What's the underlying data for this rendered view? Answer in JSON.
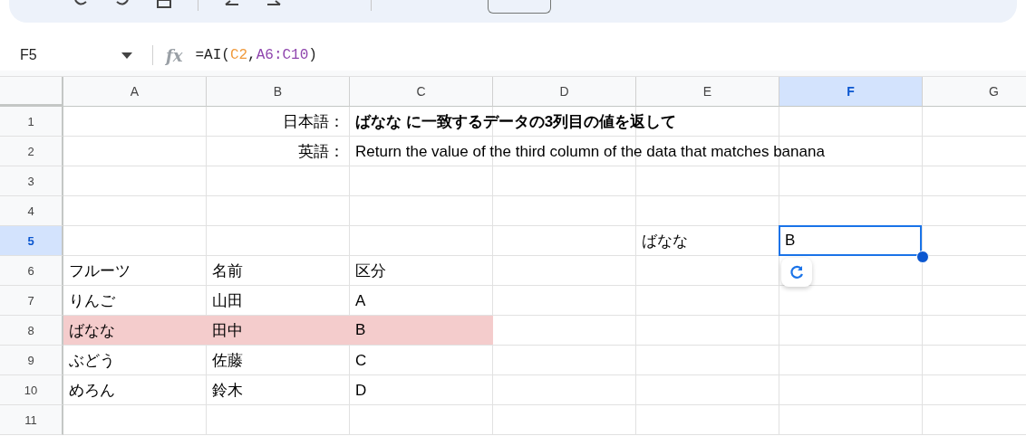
{
  "name_box": {
    "value": "F5"
  },
  "formula_bar": {
    "icon_text": "fx",
    "tokens": [
      {
        "text": "=AI("
      },
      {
        "text": "C2",
        "color": "#f09a3c"
      },
      {
        "text": ","
      },
      {
        "text": "A6:C10",
        "color": "#8e44ad"
      },
      {
        "text": ")"
      }
    ]
  },
  "grid": {
    "columns": [
      {
        "label": "A",
        "selected": false
      },
      {
        "label": "B",
        "selected": false
      },
      {
        "label": "C",
        "selected": false
      },
      {
        "label": "D",
        "selected": false
      },
      {
        "label": "E",
        "selected": false
      },
      {
        "label": "F",
        "selected": true
      },
      {
        "label": "G",
        "selected": false
      }
    ],
    "rows": [
      {
        "label": "1",
        "selected": false,
        "cells": [
          {},
          {
            "text": "日本語：",
            "right_aligned": true
          },
          {
            "text": "ばなな に一致するデータの3列目の値を返して",
            "bold": true
          },
          {},
          {},
          {},
          {}
        ]
      },
      {
        "label": "2",
        "selected": false,
        "cells": [
          {},
          {
            "text": "英語：",
            "right_aligned": true
          },
          {
            "text": "Return the value of the third column of the data that matches banana"
          },
          {},
          {},
          {},
          {}
        ]
      },
      {
        "label": "3",
        "selected": false,
        "cells": [
          {},
          {},
          {},
          {},
          {},
          {},
          {}
        ]
      },
      {
        "label": "4",
        "selected": false,
        "cells": [
          {},
          {},
          {},
          {},
          {},
          {},
          {}
        ]
      },
      {
        "label": "5",
        "selected": true,
        "cells": [
          {},
          {},
          {},
          {},
          {
            "text": "ばなな"
          },
          {
            "text": "B",
            "selected": true
          },
          {}
        ]
      },
      {
        "label": "6",
        "selected": false,
        "cells": [
          {
            "text": "フルーツ"
          },
          {
            "text": "名前"
          },
          {
            "text": "区分"
          },
          {},
          {},
          {
            "refresh_chip": true
          },
          {}
        ]
      },
      {
        "label": "7",
        "selected": false,
        "cells": [
          {
            "text": "りんご"
          },
          {
            "text": "山田"
          },
          {
            "text": "A"
          },
          {},
          {},
          {},
          {}
        ]
      },
      {
        "label": "8",
        "selected": false,
        "cells": [
          {
            "text": "ばなな",
            "highlighted": true
          },
          {
            "text": "田中",
            "highlighted": true
          },
          {
            "text": "B",
            "highlighted": true
          },
          {},
          {},
          {},
          {}
        ]
      },
      {
        "label": "9",
        "selected": false,
        "cells": [
          {
            "text": "ぶどう"
          },
          {
            "text": "佐藤"
          },
          {
            "text": "C"
          },
          {},
          {},
          {},
          {}
        ]
      },
      {
        "label": "10",
        "selected": false,
        "cells": [
          {
            "text": "めろん"
          },
          {
            "text": "鈴木"
          },
          {
            "text": "D"
          },
          {},
          {},
          {},
          {}
        ]
      },
      {
        "label": "11",
        "selected": false,
        "cells": [
          {},
          {},
          {},
          {},
          {},
          {},
          {}
        ]
      }
    ]
  }
}
